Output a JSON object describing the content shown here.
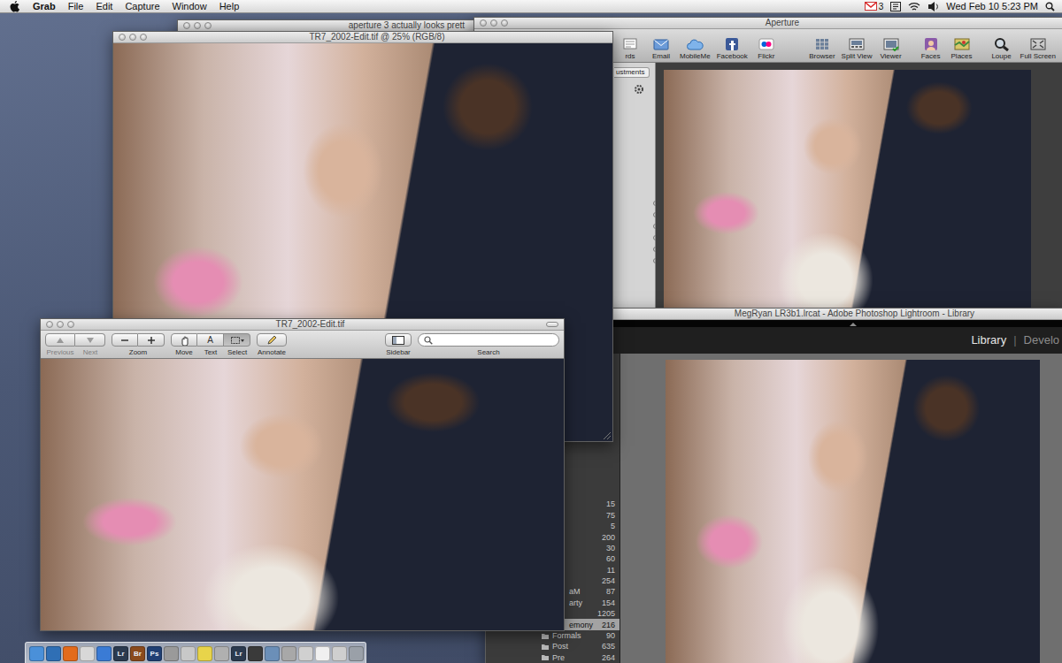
{
  "menubar": {
    "app": "Grab",
    "menus": [
      "File",
      "Edit",
      "Capture",
      "Window",
      "Help"
    ],
    "mail_count": "3",
    "clock": "Wed Feb 10 5:23 PM"
  },
  "back_window": {
    "title": "aperture 3 actually looks prett"
  },
  "aperture": {
    "title": "Aperture",
    "toolbar_left": [
      "rds",
      "Email",
      "MobileMe",
      "Facebook",
      "Flickr"
    ],
    "toolbar_right": [
      "Browser",
      "Split View",
      "Viewer",
      "Faces",
      "Places",
      "Loupe",
      "Full Screen"
    ],
    "panel_tab": "ustments"
  },
  "photoshop": {
    "title": "TR7_2002-Edit.tif @ 25% (RGB/8)"
  },
  "preview": {
    "title": "TR7_2002-Edit.tif",
    "nav": [
      {
        "label": "Previous",
        "disabled": true
      },
      {
        "label": "Next",
        "disabled": true
      }
    ],
    "zoom": {
      "label": "Zoom"
    },
    "tools": [
      {
        "label": "Move",
        "selected": false
      },
      {
        "label": "Text",
        "glyph": "A",
        "selected": false
      },
      {
        "label": "Select",
        "selected": true
      }
    ],
    "annotate": {
      "label": "Annotate"
    },
    "sidebar": {
      "label": "Sidebar"
    },
    "search": {
      "label": "Search"
    }
  },
  "lightroom": {
    "title": "MegRyan LR3b1.lrcat - Adobe Photoshop Lightroom - Library",
    "modules": [
      {
        "label": "Library",
        "selected": true
      },
      {
        "label": "Develo",
        "selected": false
      }
    ],
    "module_separator": "|",
    "folders": [
      {
        "count": "15",
        "kind": "collection",
        "selected": false
      },
      {
        "count": "75",
        "kind": "collection",
        "selected": false
      },
      {
        "count": "5",
        "kind": "collection",
        "selected": false
      },
      {
        "count": "200",
        "kind": "collection",
        "selected": false
      },
      {
        "count": "30",
        "kind": "collection",
        "selected": false
      },
      {
        "count": "60",
        "kind": "collection",
        "selected": false
      },
      {
        "count": "11",
        "kind": "collection",
        "selected": false
      },
      {
        "count": "254",
        "kind": "collection",
        "selected": false
      },
      {
        "name": "aM",
        "count": "87",
        "kind": "collection",
        "selected": false
      },
      {
        "name": "arty",
        "count": "154",
        "kind": "collection",
        "selected": false
      },
      {
        "count": "1205",
        "kind": "collection",
        "selected": false
      },
      {
        "name": "emony",
        "count": "216",
        "kind": "collection",
        "selected": true
      },
      {
        "name": "Formals",
        "count": "90",
        "kind": "folder",
        "selected": false
      },
      {
        "name": "Post",
        "count": "635",
        "kind": "folder",
        "selected": false
      },
      {
        "name": "Pre",
        "count": "264",
        "kind": "folder",
        "selected": false
      }
    ]
  },
  "dock": {
    "items": [
      {
        "color": "#4a90d9"
      },
      {
        "color": "#2f6fb5"
      },
      {
        "color": "#e36b1c"
      },
      {
        "color": "#d8d8d8"
      },
      {
        "color": "#3a7bd5"
      },
      {
        "color": "#2b3a4f",
        "text": "Lr"
      },
      {
        "color": "#8a4a1c",
        "text": "Br"
      },
      {
        "color": "#1f3f73",
        "text": "Ps"
      },
      {
        "color": "#9a9a9a"
      },
      {
        "color": "#c8c8c8"
      },
      {
        "color": "#e8d44a"
      },
      {
        "color": "#b0b0b0"
      },
      {
        "color": "#2b3a4f",
        "text": "Lr"
      },
      {
        "color": "#3a3a3a"
      },
      {
        "color": "#6b8fb8"
      },
      {
        "color": "#a8a8a8"
      },
      {
        "color": "#d0d0d0"
      },
      {
        "color": "#f0f0f0"
      },
      {
        "color": "#cfcfcf"
      },
      {
        "color": "#9aa0a8"
      }
    ]
  }
}
